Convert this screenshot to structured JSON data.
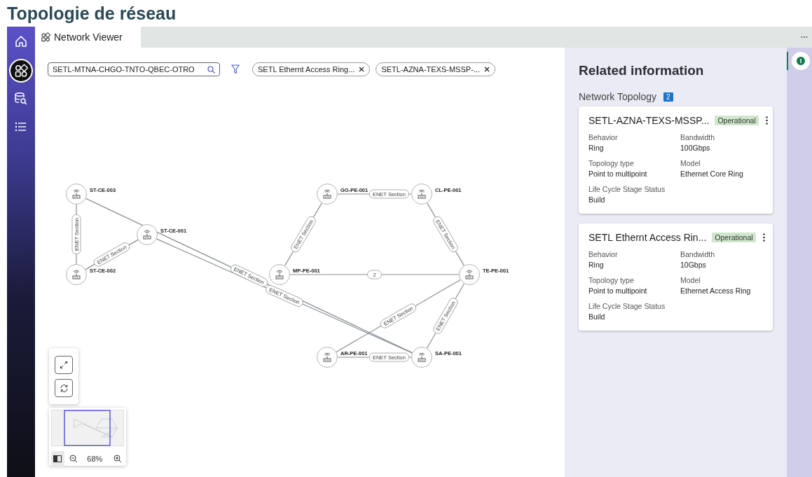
{
  "page_title": "Topologie de réseau",
  "nav": [
    {
      "kind": "home",
      "selected": false
    },
    {
      "kind": "network",
      "selected": true
    },
    {
      "kind": "db-search",
      "selected": false
    },
    {
      "kind": "list",
      "selected": false
    }
  ],
  "tabs": [
    {
      "label": "Network Viewer",
      "selected": true
    }
  ],
  "search": {
    "value": "SETL-MTNA-CHGO-TNTO-QBEC-OTRO"
  },
  "filter_chips": [
    {
      "label": "SETL Ethernt Access Ring..."
    },
    {
      "label": "SETL-AZNA-TEXS-MSSP-..."
    }
  ],
  "graph": {
    "nodes": [
      {
        "name": "ST-CE-003"
      },
      {
        "name": "ST-CE-002"
      },
      {
        "name": "ST-CE-001"
      },
      {
        "name": "GO-PE-001"
      },
      {
        "name": "CL-PE-001"
      },
      {
        "name": "MP-PE-001"
      },
      {
        "name": "TE-PE-001"
      },
      {
        "name": "AR-PE-001"
      },
      {
        "name": "SA-PE-001"
      }
    ],
    "edges": [
      {
        "label": "ENET Section"
      },
      {
        "label": "ENET Section"
      },
      {
        "label": "ENET Section"
      },
      {
        "label": "ENET Section"
      },
      {
        "label": "ENET Section"
      },
      {
        "label": "ENET Section"
      },
      {
        "label": "ENET Section"
      },
      {
        "label": "2"
      },
      {
        "label": "ENET Section"
      },
      {
        "label": "ENET Section"
      },
      {
        "label": "ENET Section"
      }
    ]
  },
  "minimap": {
    "zoom": "68%",
    "overview_selected": true
  },
  "panel": {
    "title": "Related information",
    "section": "Network Topology",
    "count": "2",
    "cards": [
      {
        "title": "SETL-AZNA-TEXS-MSSP...",
        "status": "Operational",
        "fields": [
          {
            "label": "Behavior",
            "value": "Ring"
          },
          {
            "label": "Bandwidth",
            "value": "100Gbps"
          },
          {
            "label": "Topology type",
            "value": "Point to multipoint"
          },
          {
            "label": "Model",
            "value": "Ethernet Core Ring"
          },
          {
            "label": "Life Cycle Stage Status",
            "value": "Build"
          }
        ]
      },
      {
        "title": "SETL Ethernt Access Rin...",
        "status": "Operational",
        "fields": [
          {
            "label": "Behavior",
            "value": "Ring"
          },
          {
            "label": "Bandwidth",
            "value": "10Gbps"
          },
          {
            "label": "Topology type",
            "value": "Point to multipoint"
          },
          {
            "label": "Model",
            "value": "Ethernet Access Ring"
          },
          {
            "label": "Life Cycle Stage Status",
            "value": "Build"
          }
        ]
      }
    ]
  }
}
